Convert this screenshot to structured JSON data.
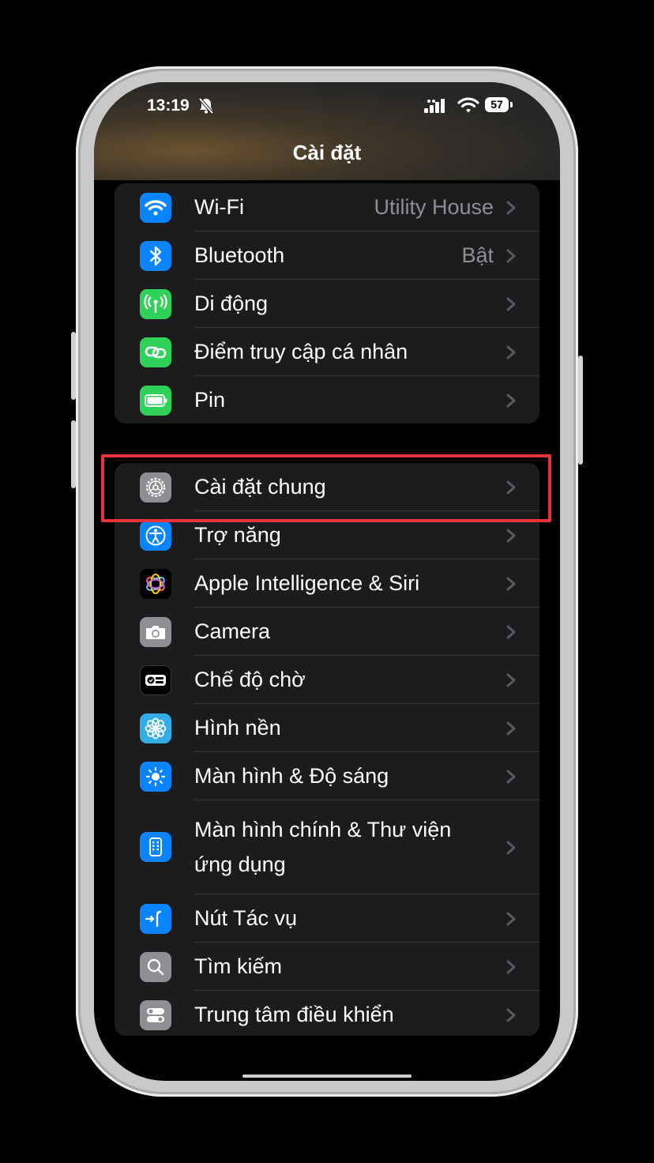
{
  "status_bar": {
    "time": "13:19",
    "battery": "57"
  },
  "nav": {
    "title": "Cài đặt"
  },
  "group1": [
    {
      "label": "Wi-Fi",
      "value": "Utility House",
      "icon": "wifi-icon",
      "color": "#0a84ff"
    },
    {
      "label": "Bluetooth",
      "value": "Bật",
      "icon": "bluetooth-icon",
      "color": "#0a84ff"
    },
    {
      "label": "Di động",
      "value": "",
      "icon": "antenna-icon",
      "color": "#30d158"
    },
    {
      "label": "Điểm truy cập cá nhân",
      "value": "",
      "icon": "hotspot-link-icon",
      "color": "#30d158"
    },
    {
      "label": "Pin",
      "value": "",
      "icon": "battery-icon",
      "color": "#30d158"
    }
  ],
  "group2": [
    {
      "label": "Cài đặt chung",
      "icon": "gear-icon",
      "color": "#8e8e93",
      "highlighted": true
    },
    {
      "label": "Trợ năng",
      "icon": "accessibility-icon",
      "color": "#0a84ff"
    },
    {
      "label": "Apple Intelligence & Siri",
      "icon": "siri-icon",
      "color": "#000000"
    },
    {
      "label": "Camera",
      "icon": "camera-icon",
      "color": "#8e8e93"
    },
    {
      "label": "Chế độ chờ",
      "icon": "standby-icon",
      "color": "#000000"
    },
    {
      "label": "Hình nền",
      "icon": "flower-icon",
      "color": "#32ade6"
    },
    {
      "label": "Màn hình & Độ sáng",
      "icon": "sun-icon",
      "color": "#0a84ff"
    },
    {
      "label": "Màn hình chính & Thư viện ứng dụng",
      "icon": "home-screen-icon",
      "color": "#0a84ff"
    },
    {
      "label": "Nút Tác vụ",
      "icon": "action-button-icon",
      "color": "#0a84ff"
    },
    {
      "label": "Tìm kiếm",
      "icon": "search-icon",
      "color": "#8e8e93"
    },
    {
      "label": "Trung tâm điều khiển",
      "icon": "toggles-icon",
      "color": "#8e8e93"
    }
  ],
  "colors": {
    "background": "#000000",
    "cell": "#1c1c1e",
    "separator": "#38383a",
    "secondary_text": "#8e8e93",
    "highlight_box": "#e8323a"
  }
}
